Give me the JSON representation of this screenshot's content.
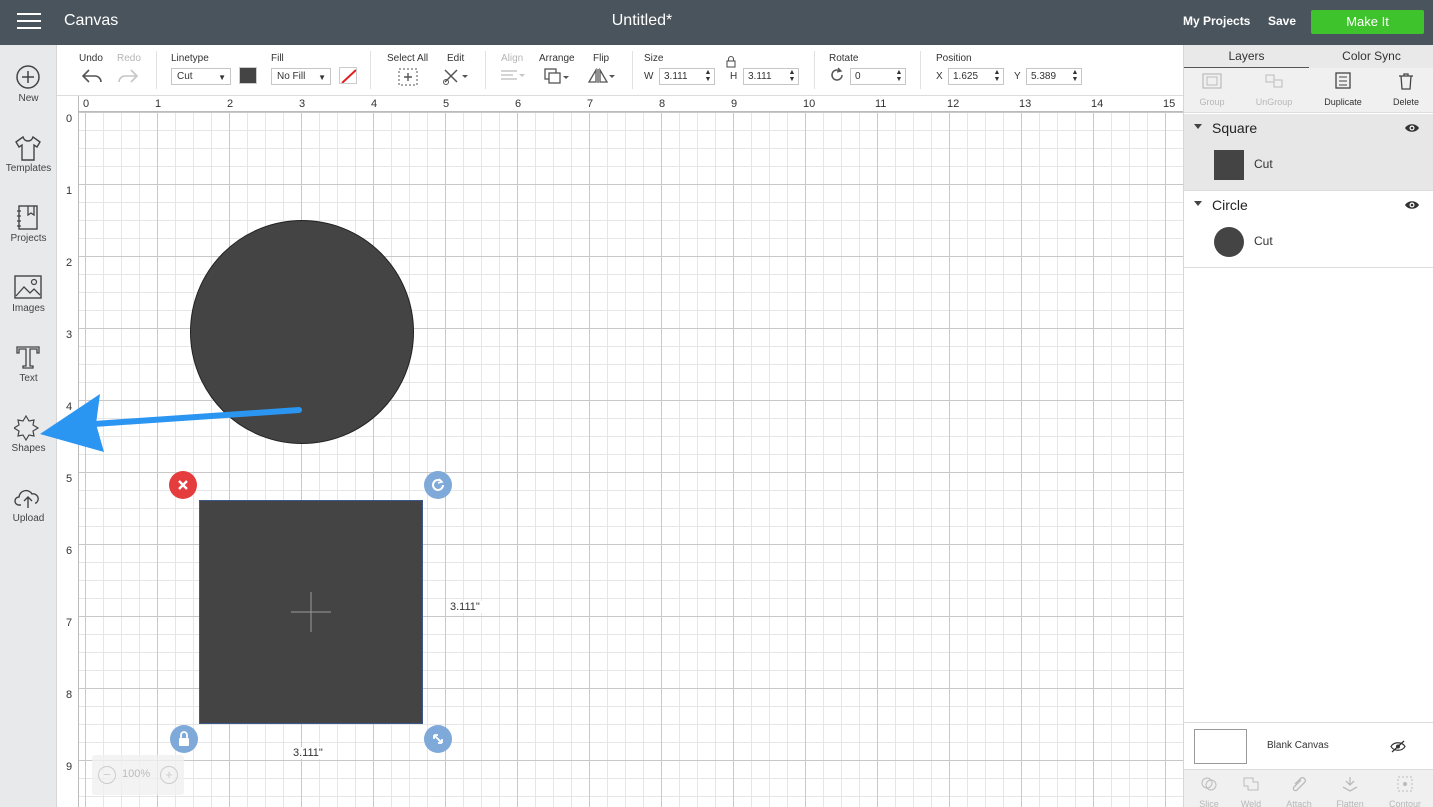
{
  "topbar": {
    "app_name": "Canvas",
    "doc_title": "Untitled*",
    "my_projects": "My Projects",
    "save": "Save",
    "make_it": "Make It"
  },
  "sidebar": {
    "items": [
      {
        "label": "New",
        "icon": "plus-circle-icon"
      },
      {
        "label": "Templates",
        "icon": "tshirt-icon"
      },
      {
        "label": "Projects",
        "icon": "projects-icon"
      },
      {
        "label": "Images",
        "icon": "image-icon"
      },
      {
        "label": "Text",
        "icon": "text-icon"
      },
      {
        "label": "Shapes",
        "icon": "shapes-icon"
      },
      {
        "label": "Upload",
        "icon": "upload-cloud-icon"
      }
    ]
  },
  "toolbar": {
    "undo": "Undo",
    "redo": "Redo",
    "linetype_label": "Linetype",
    "linetype_value": "Cut",
    "fill_label": "Fill",
    "fill_value": "No Fill",
    "select_all": "Select All",
    "edit": "Edit",
    "align": "Align",
    "arrange": "Arrange",
    "flip": "Flip",
    "size_label": "Size",
    "w_label": "W",
    "w_value": "3.111",
    "h_label": "H",
    "h_value": "3.111",
    "rotate_label": "Rotate",
    "rotate_value": "0",
    "position_label": "Position",
    "x_label": "X",
    "x_value": "1.625",
    "y_label": "Y",
    "y_value": "5.389"
  },
  "rulers": {
    "top": [
      "0",
      "1",
      "2",
      "3",
      "4",
      "5",
      "6",
      "7",
      "8",
      "9",
      "10",
      "11",
      "12",
      "13",
      "14",
      "15"
    ],
    "left": [
      "0",
      "1",
      "2",
      "3",
      "4",
      "5",
      "6",
      "7",
      "8",
      "9"
    ]
  },
  "canvas": {
    "width_dim": "3.111\"",
    "height_dim": "3.111\"",
    "zoom": "100%",
    "zoom_minus": "−",
    "zoom_plus": "+"
  },
  "right_panel": {
    "tabs": [
      "Layers",
      "Color Sync"
    ],
    "actions": [
      {
        "label": "Group",
        "enabled": false
      },
      {
        "label": "UnGroup",
        "enabled": false
      },
      {
        "label": "Duplicate",
        "enabled": true
      },
      {
        "label": "Delete",
        "enabled": true
      }
    ],
    "layers": [
      {
        "name": "Square",
        "op": "Cut"
      },
      {
        "name": "Circle",
        "op": "Cut"
      }
    ],
    "blank_canvas": "Blank Canvas",
    "bottom_actions": [
      "Slice",
      "Weld",
      "Attach",
      "Flatten",
      "Contour"
    ]
  },
  "colors": {
    "topbar": "#4a545c",
    "make_it": "#3fc32c",
    "shape_fill": "#444444",
    "arrow": "#2b95f2",
    "delete_handle": "#e53d3d",
    "blue_handle": "#7ea9d9"
  }
}
